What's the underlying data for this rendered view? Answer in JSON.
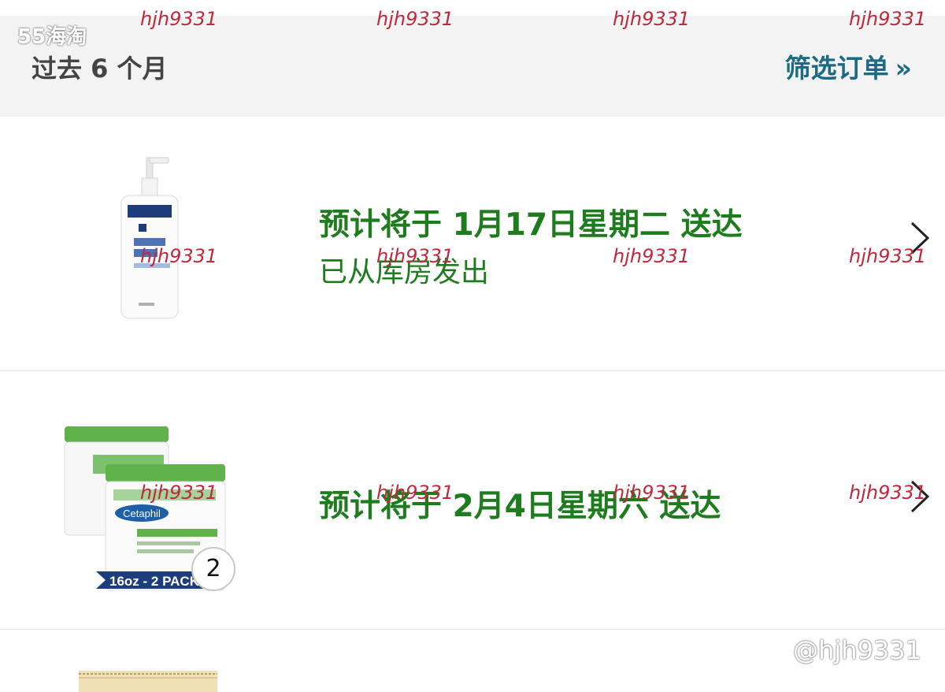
{
  "header": {
    "period_label": "过去 6 个月",
    "filter_label": "筛选订单",
    "filter_chevron": "»"
  },
  "orders": [
    {
      "status_title": "预计将于 1月17日星期二 送达",
      "status_sub": "已从库房发出",
      "product_icon": "lotion-bottle-icon"
    },
    {
      "status_title": "预计将于 2月4日星期六 送达",
      "quantity": "2",
      "product_icon": "cream-jar-icon",
      "jar_brand": "Cetaphil",
      "jar_banner": "16oz - 2 PACK"
    },
    {
      "product_icon": "product-box-icon"
    }
  ],
  "overlay": {
    "app_logo": "55海淘",
    "watermark": "hjh9331",
    "handle": "@hjh9331"
  },
  "colors": {
    "status_green": "#1e7c1e",
    "filter_link": "#1d6a83",
    "header_bg": "#f3f3f3"
  }
}
